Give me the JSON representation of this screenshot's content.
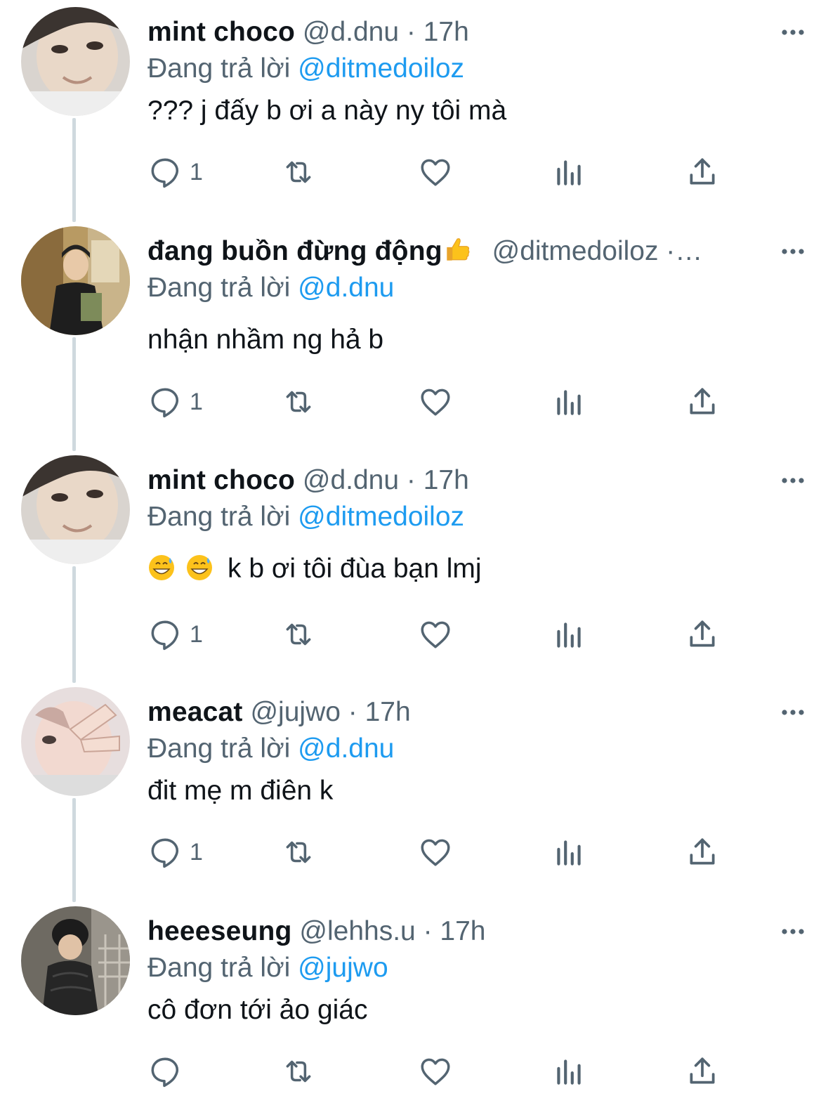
{
  "tweets": [
    {
      "name": "mint choco",
      "handle": "@d.dnu",
      "dot": " · ",
      "time": "17h",
      "reply_label": "Đang trả lời ",
      "reply_to": "@ditmedoiloz",
      "text": "??? j đấy b ơi a này ny tôi mà",
      "reply_count": "1"
    },
    {
      "name": "đang buồn đừng động",
      "handle": "@ditmedoiloz",
      "dot": " ·…",
      "time": "",
      "reply_label": "Đang trả lời ",
      "reply_to": "@d.dnu",
      "text": "nhận nhầm ng hả b",
      "reply_count": "1"
    },
    {
      "name": "mint choco",
      "handle": "@d.dnu",
      "dot": " · ",
      "time": "17h",
      "reply_label": "Đang trả lời ",
      "reply_to": "@ditmedoiloz",
      "text": "k b ơi tôi đùa bạn lmj",
      "reply_count": "1"
    },
    {
      "name": "meacat",
      "handle": "@jujwo",
      "dot": " · ",
      "time": "17h",
      "reply_label": "Đang trả lời ",
      "reply_to": "@d.dnu",
      "text": "đit mẹ m điên k",
      "reply_count": "1"
    },
    {
      "name": "heeeseung",
      "handle": "@lehhs.u",
      "dot": " · ",
      "time": "17h",
      "reply_label": "Đang trả lời ",
      "reply_to": "@jujwo",
      "text": "cô đơn tới ảo giác",
      "reply_count": ""
    }
  ],
  "icons": {
    "reply": "reply-icon",
    "retweet": "retweet-icon",
    "like": "heart-icon",
    "views": "analytics-icon",
    "share": "share-icon",
    "more": "more-icon"
  },
  "colors": {
    "text": "#0f1419",
    "muted": "#536471",
    "link": "#1d9bf0",
    "thread_line": "#cfd9de"
  }
}
